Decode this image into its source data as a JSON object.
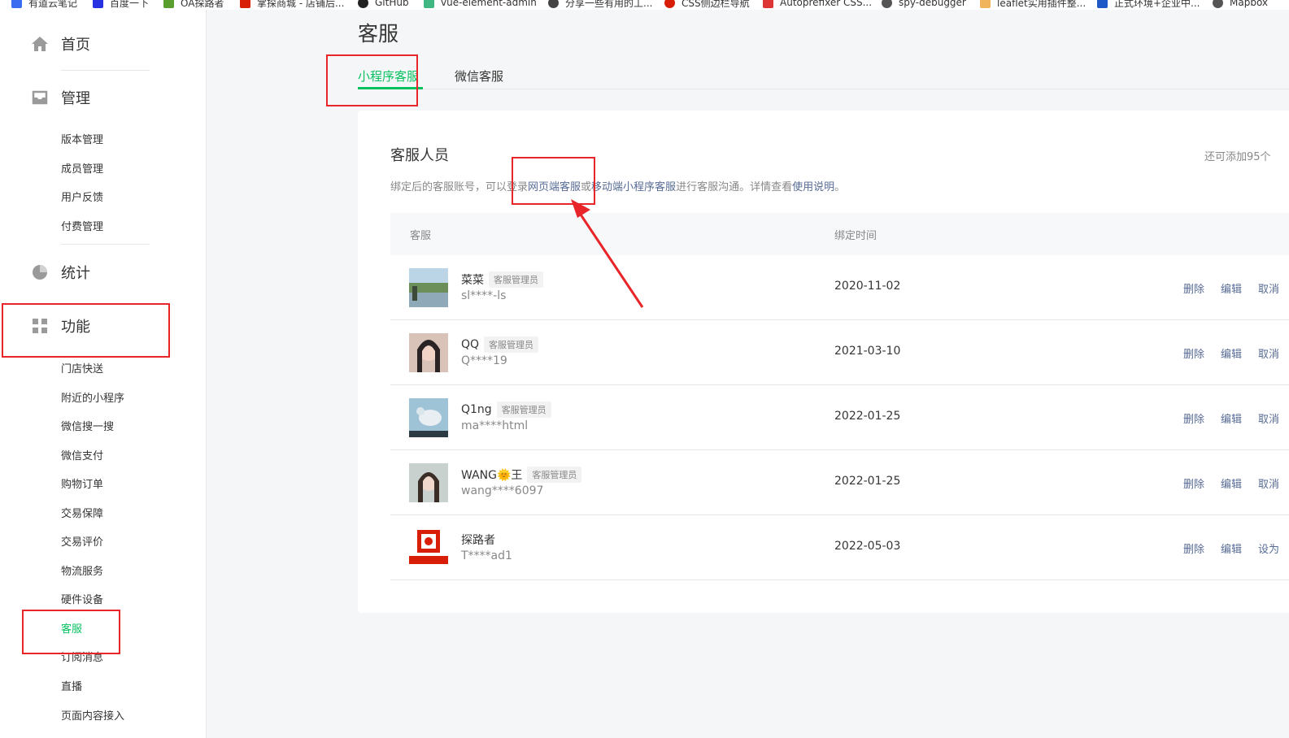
{
  "bookmarks": [
    {
      "label": "有道云笔记",
      "color": "#3a6df0"
    },
    {
      "label": "百度一下",
      "color": "#2932e1"
    },
    {
      "label": "OA探路者",
      "color": "#5a9e2f"
    },
    {
      "label": "掌探商城 - 店铺后...",
      "color": "#d81e06"
    },
    {
      "label": "GitHub",
      "color": "#222222"
    },
    {
      "label": "vue-element-admin",
      "color": "#41b883"
    },
    {
      "label": "分享一些有用的工...",
      "color": "#444444"
    },
    {
      "label": "CSS侧边栏导航",
      "color": "#d81e06"
    },
    {
      "label": "Autoprefixer CSS...",
      "color": "#dd3735"
    },
    {
      "label": "spy-debugger",
      "color": "#555555"
    },
    {
      "label": "leaflet实用插件整...",
      "color": "#f0b55c"
    },
    {
      "label": "正式环境+企业中...",
      "color": "#1f58c7"
    },
    {
      "label": "Mapbox",
      "color": "#555555"
    }
  ],
  "sidebar": {
    "home": {
      "label": "首页",
      "icon": "home-icon"
    },
    "manage": {
      "label": "管理",
      "icon": "inbox-icon",
      "items": [
        "版本管理",
        "成员管理",
        "用户反馈",
        "付费管理"
      ]
    },
    "stats": {
      "label": "统计",
      "icon": "pie-chart-icon"
    },
    "features": {
      "label": "功能",
      "icon": "grid-icon",
      "items": [
        "门店快送",
        "附近的小程序",
        "微信搜一搜",
        "微信支付",
        "购物订单",
        "交易保障",
        "交易评价",
        "物流服务",
        "硬件设备",
        "客服",
        "订阅消息",
        "直播",
        "页面内容接入"
      ],
      "active_item": "客服"
    }
  },
  "main": {
    "title": "客服",
    "tabs": [
      {
        "label": "小程序客服",
        "active": true
      },
      {
        "label": "微信客服",
        "active": false
      }
    ],
    "card": {
      "title": "客服人员",
      "quota": "还可添加95个",
      "desc": {
        "part1": "绑定后的客服账号，可以登录",
        "link1": "网页端客服",
        "part2": "或",
        "link2": "移动端小程序客服",
        "part3": "进行客服沟通。详情查看",
        "link3": "使用说明",
        "part4": "。"
      },
      "columns": {
        "agent": "客服",
        "bind_time": "绑定时间"
      },
      "rows": [
        {
          "name": "菜菜",
          "role": "客服管理员",
          "account": "sl****-ls",
          "date": "2020-11-02",
          "actions": [
            "删除",
            "编辑",
            "取消"
          ]
        },
        {
          "name": "QQ",
          "role": "客服管理员",
          "account": "Q****19",
          "date": "2021-03-10",
          "actions": [
            "删除",
            "编辑",
            "取消"
          ]
        },
        {
          "name": "Q1ng",
          "role": "客服管理员",
          "account": "ma****html",
          "date": "2022-01-25",
          "actions": [
            "删除",
            "编辑",
            "取消"
          ]
        },
        {
          "name": "WANG🌞王",
          "role": "客服管理员",
          "account": "wang****6097",
          "date": "2022-01-25",
          "actions": [
            "删除",
            "编辑",
            "取消"
          ]
        },
        {
          "name": "探路者",
          "role": "",
          "account": "T****ad1",
          "date": "2022-05-03",
          "actions": [
            "删除",
            "编辑",
            "设为"
          ]
        }
      ]
    }
  },
  "colors": {
    "accent": "#07c160",
    "link": "#576b95",
    "annotation": "#e8262a"
  }
}
